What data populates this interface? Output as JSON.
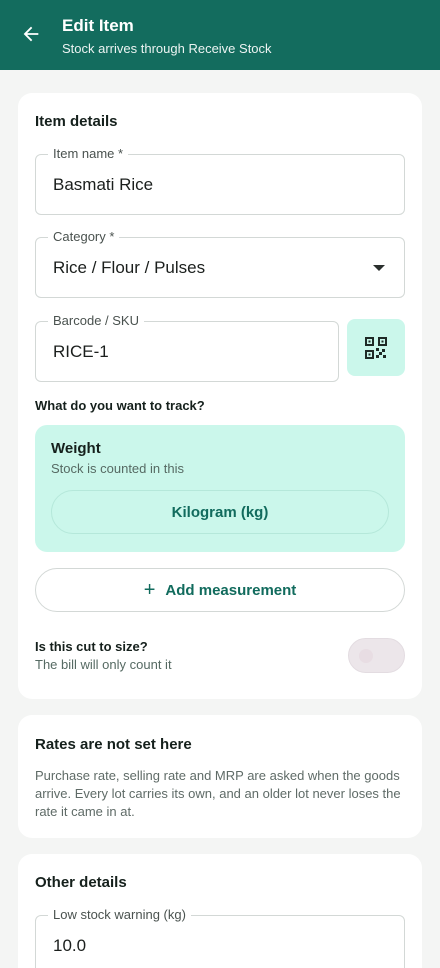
{
  "header": {
    "title": "Edit Item",
    "subtitle": "Stock arrives through Receive Stock"
  },
  "item_details": {
    "section_title": "Item details",
    "item_name": {
      "label": "Item name *",
      "value": "Basmati Rice"
    },
    "category": {
      "label": "Category *",
      "value": "Rice / Flour / Pulses"
    },
    "barcode": {
      "label": "Barcode / SKU",
      "value": "RICE-1"
    },
    "track_question": "What do you want to track?",
    "track_unit": {
      "title": "Weight",
      "subtitle": "Stock is counted in this",
      "unit": "Kilogram (kg)"
    },
    "add_measurement": {
      "icon": "+",
      "label": "Add measurement"
    },
    "cut_to_size": {
      "title": "Is this cut to size?",
      "subtitle": "The bill will only count it",
      "enabled": false
    }
  },
  "rates_notice": {
    "title": "Rates are not set here",
    "body": "Purchase rate, selling rate and MRP are asked when the goods arrive. Every lot carries its own, and an older lot never loses the rate it came in at."
  },
  "other_details": {
    "section_title": "Other details",
    "low_stock": {
      "label": "Low stock warning (kg)",
      "value": "10.0"
    }
  },
  "colors": {
    "primary": "#136c5e",
    "accent_soft": "#cbf7eb",
    "background": "#f4f5f4"
  }
}
